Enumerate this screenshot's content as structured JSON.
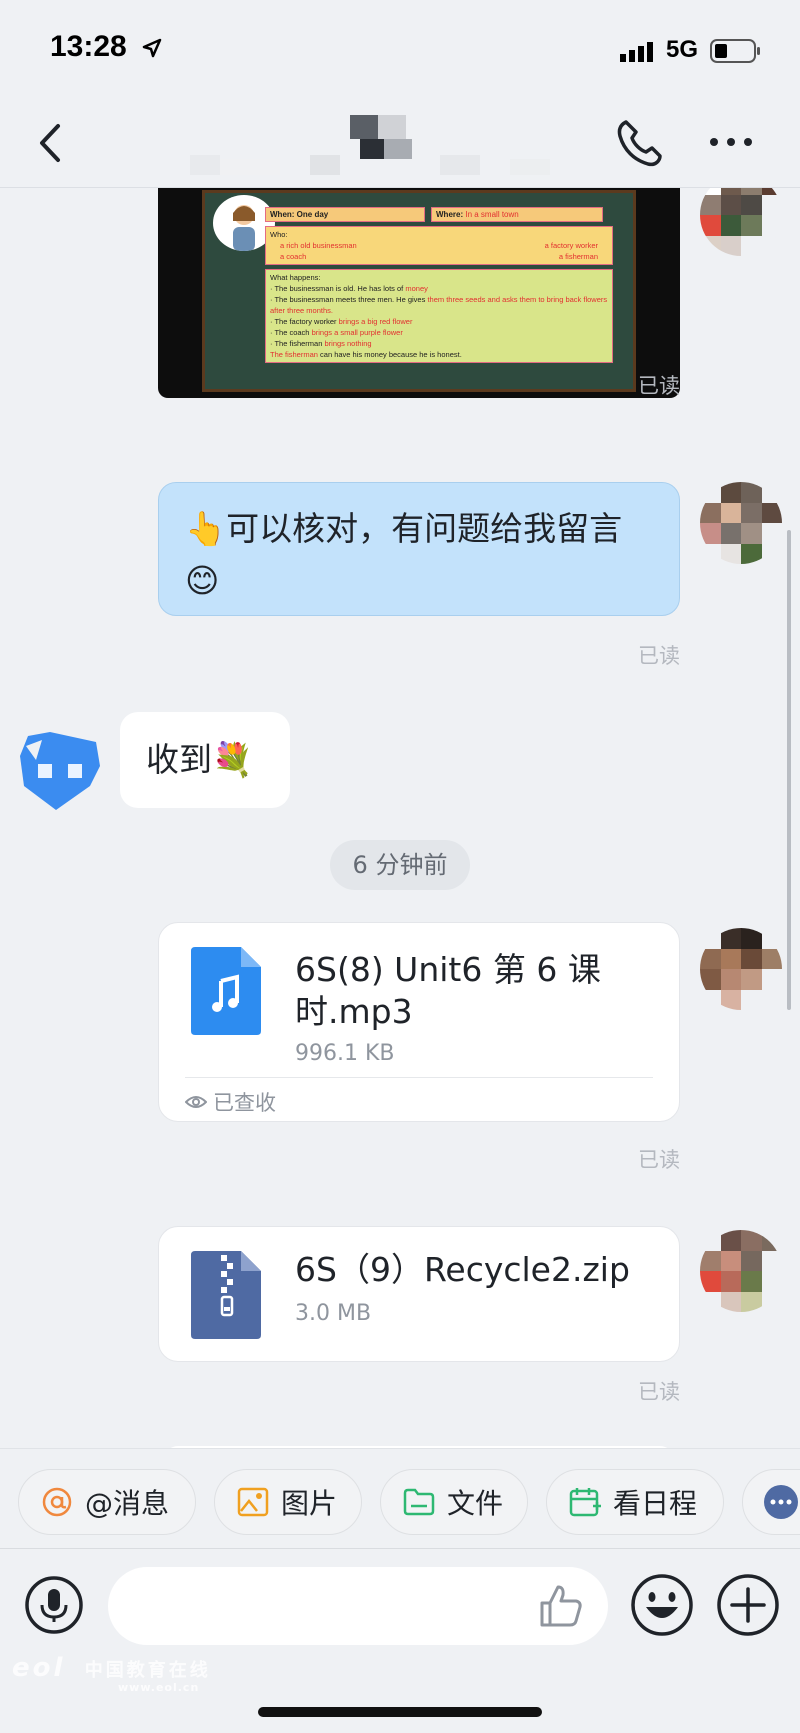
{
  "status_bar": {
    "time": "13:28",
    "network": "5G"
  },
  "nav": {
    "title": ""
  },
  "image_message": {
    "when_label": "When:",
    "when_value": "One day",
    "where_label": "Where:",
    "where_value": "In a small town",
    "who_label": "Who:",
    "who": [
      "a rich old businessman",
      "a factory worker",
      "a coach",
      "a fisherman"
    ],
    "what_label": "What happens:",
    "lines": [
      {
        "text": "· The businessman is old. He has lots of",
        "answer": "money"
      },
      {
        "text": "· The businessman meets three men. He gives",
        "answer": "them three seeds and asks them to bring back flowers after three months."
      },
      {
        "text": "· The factory worker",
        "answer": "brings a big red flower"
      },
      {
        "text": "· The coach",
        "answer": "brings a small purple flower"
      },
      {
        "text": "· The fisherman",
        "answer": "brings nothing"
      },
      {
        "text": "can have his money because he is honest.",
        "answer": "The fisherman"
      }
    ]
  },
  "messages": {
    "read_label": "已读",
    "outgoing_text": "👆可以核对，有问题给我留言😊",
    "incoming_text": "收到💐",
    "time_divider": "6 分钟前",
    "file1": {
      "name": "6S(8) Unit6 第 6 课时.mp3",
      "size": "996.1 KB",
      "status": "已查收"
    },
    "file2": {
      "name": "6S（9）Recycle2.zip",
      "size": "3.0 MB"
    }
  },
  "quick_actions": [
    {
      "label": "@消息",
      "icon": "at-icon",
      "color": "#f0883e"
    },
    {
      "label": "图片",
      "icon": "image-icon",
      "color": "#f0a020"
    },
    {
      "label": "文件",
      "icon": "folder-icon",
      "color": "#2eb872"
    },
    {
      "label": "看日程",
      "icon": "calendar-icon",
      "color": "#2eb872"
    }
  ],
  "input": {
    "placeholder": ""
  },
  "watermark": {
    "text": "中国教育在线",
    "url": "www.eol.cn"
  },
  "colors": {
    "background": "#eff1f4",
    "outgoing_bubble": "#c3e2fb",
    "file_audio_icon": "#2d8cf0",
    "file_zip_icon": "#4f6aa3"
  }
}
